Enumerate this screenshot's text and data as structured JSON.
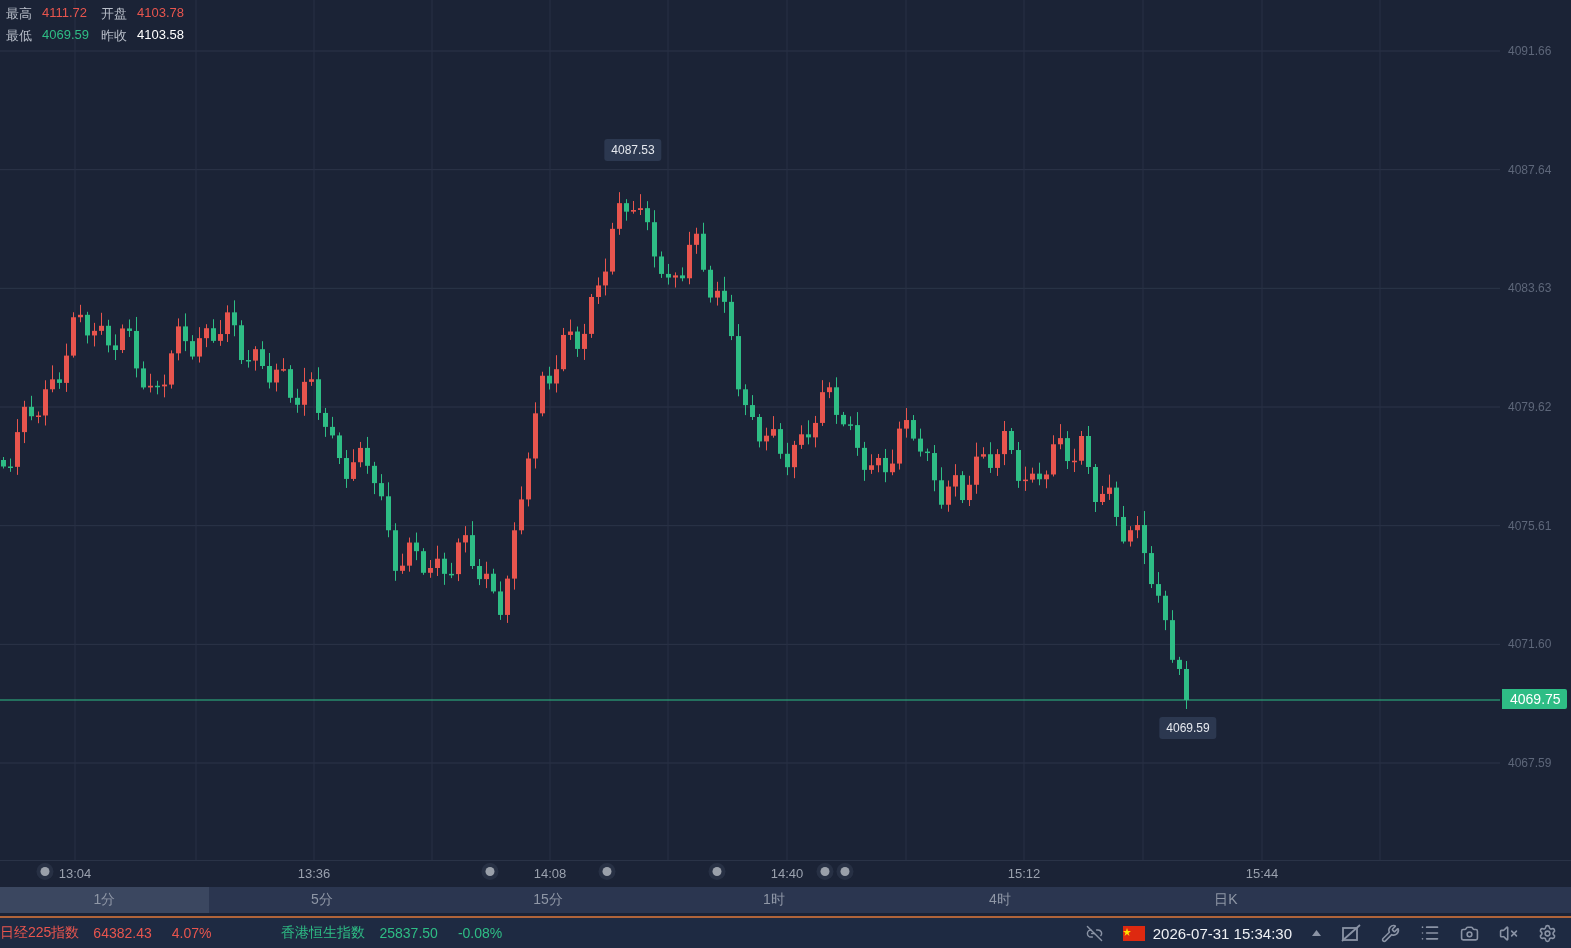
{
  "quote": {
    "rows": [
      [
        {
          "label": "最高",
          "value": "4111.72",
          "color": "#e8554e"
        },
        {
          "label": "开盘",
          "value": "4103.78",
          "color": "#e8554e"
        }
      ],
      [
        {
          "label": "最低",
          "value": "4069.59",
          "color": "#2ebd85"
        },
        {
          "label": "昨收",
          "value": "4103.58",
          "color": "#ffffff"
        }
      ]
    ]
  },
  "chart": {
    "y_ticks": [
      "4091.66",
      "4087.64",
      "4083.63",
      "4079.62",
      "4075.61",
      "4071.60",
      "4067.59"
    ],
    "x_ticks": [
      "13:04",
      "13:36",
      "14:08",
      "14:40",
      "15:12",
      "15:44"
    ],
    "high_label": "4087.53",
    "low_label": "4069.59",
    "last_price": "4069.75"
  },
  "periods": [
    {
      "label": "1分",
      "selected": true
    },
    {
      "label": "5分",
      "selected": false
    },
    {
      "label": "15分",
      "selected": false
    },
    {
      "label": "1时",
      "selected": false
    },
    {
      "label": "4时",
      "selected": false
    },
    {
      "label": "日K",
      "selected": false
    }
  ],
  "ticker": [
    {
      "name": "日经225指数",
      "value": "64382.43",
      "change": "4.07%",
      "color": "#e8554e"
    },
    {
      "name": "香港恒生指数",
      "value": "25837.50",
      "change": "-0.08%",
      "color": "#2ebd85"
    }
  ],
  "status_bar": {
    "datetime": "2026-07-31 15:34:30"
  }
}
